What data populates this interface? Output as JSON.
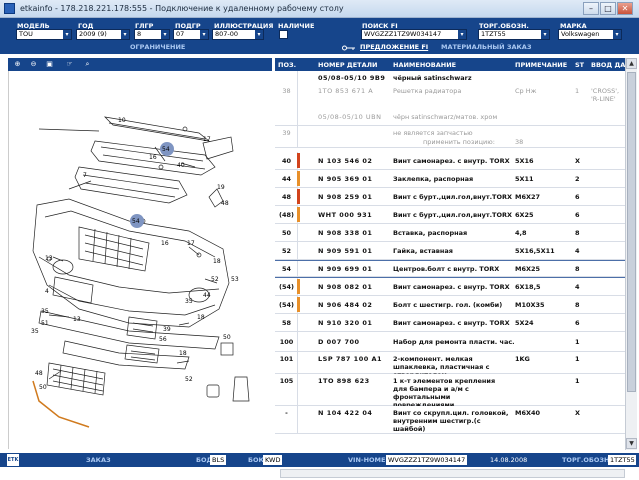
{
  "window": {
    "title": "etkainfo - 178.218.221.178:555 - Подключение к удаленному рабочему столу",
    "minimize": "–",
    "maximize": "□",
    "close": "✕"
  },
  "toolbar": {
    "fields": [
      {
        "label": "МОДЕЛЬ",
        "value": "TOU"
      },
      {
        "label": "ГОД",
        "value": "2009 (9)"
      },
      {
        "label": "ГЛГР",
        "value": "8"
      },
      {
        "label": "ПОДГР",
        "value": "07"
      },
      {
        "label": "ИЛЛЮСТРАЦИЯ",
        "value": "807-00"
      },
      {
        "label": "НАЛИЧИЕ",
        "value": ""
      },
      {
        "label": "ПОИСК FI",
        "value": "WVGZZZ1TZ9W034147"
      },
      {
        "label": "ТОРГ.ОБОЗН.",
        "value": "1TZT55"
      },
      {
        "label": "МАРКА",
        "value": "Volkswagen"
      }
    ],
    "links": {
      "restriction": "ОГРАНИЧЕНИЕ",
      "offer": "ПРЕДЛОЖЕНИЕ FI",
      "material_order": "МАТЕРИАЛЬНЫЙ ЗАКАЗ"
    }
  },
  "left_toolbar": {
    "icons": [
      "zoom-in-icon",
      "zoom-out-icon",
      "fit-icon",
      "pan-icon",
      "magnifier-icon"
    ],
    "glyphs": [
      "⊕",
      "⊖",
      "▣",
      "☞",
      "⌕"
    ]
  },
  "illustration": {
    "callouts": [
      "10",
      "7",
      "54",
      "16",
      "40",
      "13",
      "17",
      "18",
      "16",
      "54",
      "52",
      "53",
      "44",
      "4",
      "35",
      "51",
      "35",
      "18",
      "39",
      "56",
      "18",
      "35",
      "13",
      "48",
      "50",
      "50",
      "52",
      "17",
      "19",
      "48"
    ]
  },
  "table": {
    "headers": {
      "pos": "ПОЗ.",
      "num": "НОМЕР ДЕТАЛИ",
      "name": "НАИМЕНОВАНИЕ",
      "note": "ПРИМЕЧАНИЕ",
      "qty": "ST",
      "input": "ВВОД ДА"
    },
    "rows": [
      {
        "pos": "",
        "num": "05/08-05/10 9B9",
        "name": "чёрный satinschwarz",
        "note": "",
        "qty": "",
        "style": "plain"
      },
      {
        "pos": "38",
        "num": "1TO 853 671 A",
        "name": "Решетка радиатора",
        "note": "Cp Нж",
        "qty": "1",
        "note2": "'CROSS', 'R-LINE'",
        "style": "grey"
      },
      {
        "pos": "",
        "num": "05/08-05/10 UBN",
        "name": "чёрн satinschwarz/матов. хром",
        "note": "",
        "qty": "",
        "style": "grey"
      },
      {
        "pos": "39",
        "num": "",
        "name": "не является запчастью",
        "name2": "применить позицию:",
        "note": "38",
        "qty": "",
        "style": "grey"
      },
      {
        "pos": "40",
        "num": "N 103 546 02",
        "name": "Винт самонарез. с внутр. TORX",
        "note": "5X16",
        "qty": "X",
        "style": "plain"
      },
      {
        "pos": "44",
        "num": "N 905 369 01",
        "name": "Заклепка, распорная",
        "note": "5X11",
        "qty": "2",
        "style": "plain"
      },
      {
        "pos": "48",
        "num": "N 908 259 01",
        "name": "Винт с бурт.,цил.гол,внут.TORX",
        "note": "M6X27",
        "qty": "6",
        "style": "plain"
      },
      {
        "pos": "(48)",
        "num": "WHT 000 931",
        "name": "Винт с бурт.,цил.гол,внут.TORX",
        "note": "6X25",
        "qty": "6",
        "style": "plain"
      },
      {
        "pos": "50",
        "num": "N 908 338 01",
        "name": "Вставка, распорная",
        "note": "4,8",
        "qty": "8",
        "style": "plain"
      },
      {
        "pos": "52",
        "num": "N 909 591 01",
        "name": "Гайка, вставная",
        "note": "5X16,5X11",
        "qty": "4",
        "style": "plain"
      },
      {
        "pos": "54",
        "num": "N 909 699 01",
        "name": "Центров.болт с внутр. TORX",
        "note": "M6X25",
        "qty": "8",
        "style": "sel"
      },
      {
        "pos": "(54)",
        "num": "N 908 082 01",
        "name": "Винт самонарез. с внутр. TORX",
        "note": "6X18,5",
        "qty": "4",
        "style": "plain"
      },
      {
        "pos": "(54)",
        "num": "N 906 484 02",
        "name": "Болт с шестигр. гол. (комби)",
        "note": "M10X35",
        "qty": "8",
        "style": "plain"
      },
      {
        "pos": "58",
        "num": "N 910 320 01",
        "name": "Винт самонарез. с внутр. TORX",
        "note": "5X24",
        "qty": "6",
        "style": "plain"
      },
      {
        "pos": "100",
        "num": "D 007 700",
        "name": "Набор для ремонта пласти. час.",
        "note": "",
        "qty": "1",
        "style": "plain"
      },
      {
        "pos": "101",
        "num": "LSP 787 100 A1",
        "name": "2-компонент. мелкая шпаклевка, пластичная с отвердителем",
        "note": "1KG",
        "qty": "1",
        "style": "plain"
      },
      {
        "pos": "105",
        "num": "1TO 898 623",
        "name": "1 к-т элементов крепления для бампера и а/м с фронтальными повреждениями",
        "note": "",
        "qty": "1",
        "style": "plain"
      },
      {
        "pos": "-",
        "num": "N 104 422 04",
        "name": "Винт со скрупл.цил. головкой, внутренним шестигр.(с шайбой)",
        "note": "M6X40",
        "qty": "X",
        "style": "plain"
      }
    ]
  },
  "statusbar": {
    "logo": "ETK",
    "order_label": "ЗАКАЗ",
    "bod_label": "БОД",
    "bod_value": "BLS",
    "bok_label": "БОК",
    "bok_value": "KWD",
    "vin_label": "VIN-НОМЕР",
    "vin_value": "WVGZZZ1TZ9W034147",
    "date_value": "14.08.2008",
    "trade_label": "ТОРГ.ОБОЗН.",
    "trade_value": "1TZT55"
  },
  "colors": {
    "toolbar_bg": "#16458b",
    "pos_mark_red": "#d2431c",
    "pos_mark_orange": "#e8902a"
  }
}
